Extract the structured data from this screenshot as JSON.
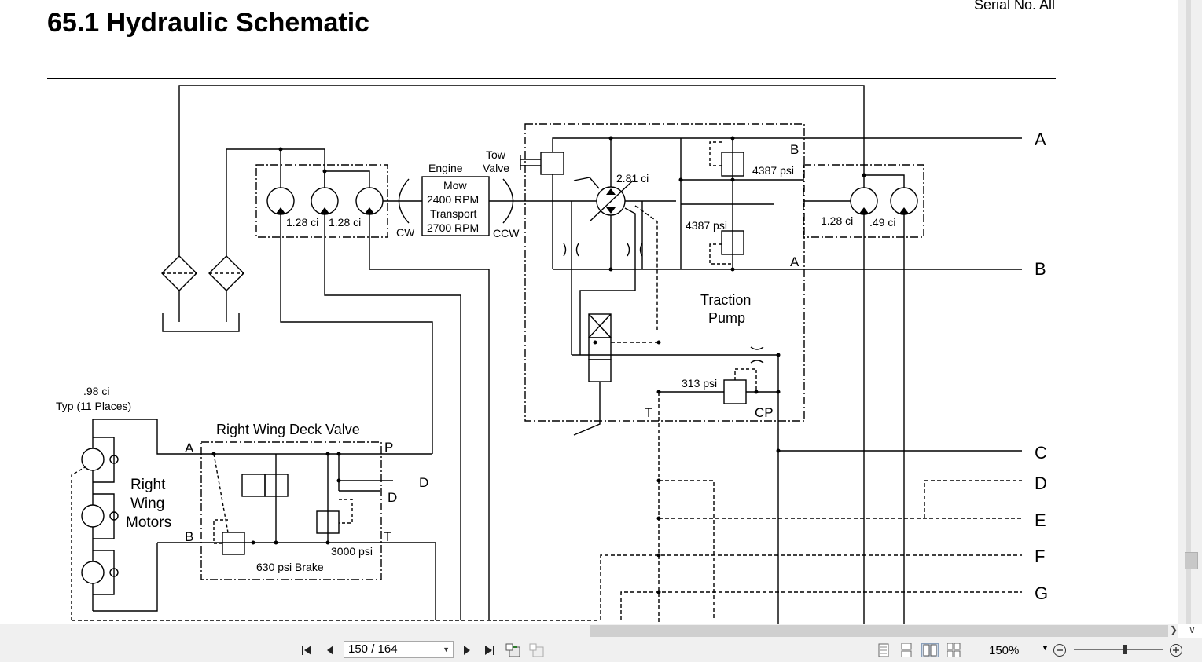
{
  "document": {
    "title": "65.1 Hydraulic Schematic",
    "serial": "Serial No. All"
  },
  "schematic": {
    "port_labels": [
      "A",
      "B",
      "C",
      "D",
      "E",
      "F",
      "G"
    ],
    "engine": {
      "label": "Engine",
      "mow": "Mow",
      "mow_rpm": "2400 RPM",
      "transport": "Transport",
      "transport_rpm": "2700 RPM",
      "cw": "CW",
      "ccw": "CCW"
    },
    "pumps_left": [
      "1.28 ci",
      "1.28 ci"
    ],
    "pumps_right": [
      "1.28 ci",
      ".49 ci"
    ],
    "tow_valve": [
      "Tow",
      "Valve"
    ],
    "traction_pump": {
      "label1": "Traction",
      "label2": "Pump",
      "displacement": "2.81 ci",
      "relief_top": "4387 psi",
      "relief_bottom": "4387 psi",
      "charge_relief": "313 psi",
      "port_b": "B",
      "port_a": "A",
      "port_t": "T",
      "port_cp": "CP"
    },
    "wing_motors": {
      "displacement": ".98 ci",
      "places": "Typ (11 Places)",
      "label1": "Right",
      "label2": "Wing",
      "label3": "Motors"
    },
    "deck_valve": {
      "label": "Right Wing Deck Valve",
      "port_a": "A",
      "port_b": "B",
      "port_p": "P",
      "port_t": "T",
      "relief": "3000 psi",
      "brake": "630 psi Brake",
      "d1": "D",
      "d2": "D"
    }
  },
  "toolbar": {
    "page_value": "150 / 164",
    "zoom": "150%"
  },
  "icons": [
    "first-page-icon",
    "previous-page-icon",
    "next-page-icon",
    "last-page-icon",
    "previous-view-icon",
    "next-view-icon",
    "single-page-icon",
    "continuous-icon",
    "facing-icon",
    "continuous-facing-icon",
    "zoom-out-icon",
    "zoom-in-icon"
  ]
}
